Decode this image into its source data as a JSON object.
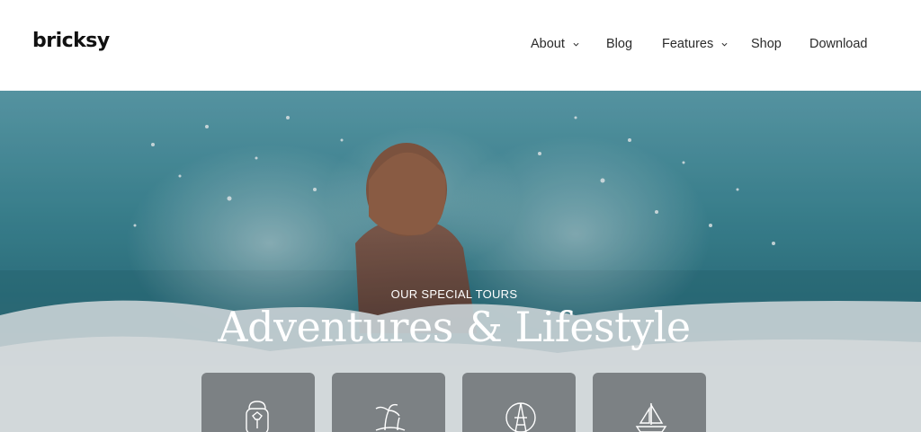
{
  "brand": {
    "logo_text": "bricksy"
  },
  "nav": {
    "items": [
      {
        "label": "About",
        "has_dropdown": true
      },
      {
        "label": "Blog",
        "has_dropdown": false
      },
      {
        "label": "Features",
        "has_dropdown": true
      },
      {
        "label": "Shop",
        "has_dropdown": false
      },
      {
        "label": "Download",
        "has_dropdown": false
      }
    ]
  },
  "hero": {
    "eyebrow": "OUR SPECIAL TOURS",
    "title": "Adventures & Lifestyle",
    "background": "woman-splashing-in-ocean-waves",
    "cards": [
      {
        "icon": "backpack-icon"
      },
      {
        "icon": "palm-island-icon"
      },
      {
        "icon": "eiffel-globe-icon"
      },
      {
        "icon": "sailboat-icon"
      }
    ]
  },
  "colors": {
    "header_bg": "#ffffff",
    "nav_text": "#2a2a2a",
    "hero_text": "#ffffff",
    "card_bg": "rgba(90,95,98,0.72)"
  }
}
